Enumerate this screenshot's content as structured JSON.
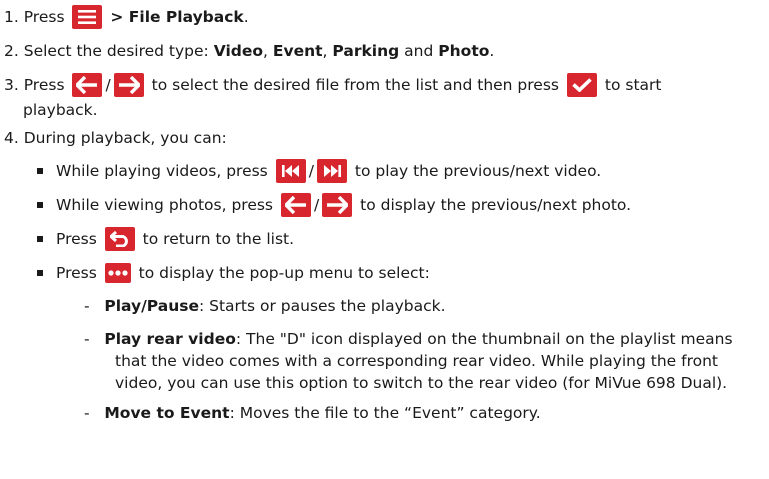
{
  "steps": {
    "s1": {
      "num": "1.",
      "pre": "Press",
      "post": "> File Playback",
      "end": "."
    },
    "s2": {
      "num": "2.",
      "pre": "Select the desired type:",
      "t1": "Video",
      "c1": ",",
      "t2": "Event",
      "c2": ",",
      "t3": "Parking",
      "and": "and",
      "t4": "Photo",
      "end": "."
    },
    "s3": {
      "num": "3.",
      "pre": "Press",
      "slash": "/",
      "mid": "to select the desired file from the list and then press",
      "post": "to start",
      "cont": "playback."
    },
    "s4": {
      "num": "4.",
      "text": "During playback, you can:"
    }
  },
  "bullets": {
    "b1": {
      "pre": "While playing videos, press",
      "slash": "/",
      "post": "to play the previous/next video."
    },
    "b2": {
      "pre": "While viewing photos, press",
      "slash": "/",
      "post": "to display the previous/next photo."
    },
    "b3": {
      "pre": "Press",
      "post": "to return to the list."
    },
    "b4": {
      "pre": "Press",
      "post": "to display the pop-up menu to select:"
    }
  },
  "menu": {
    "m1": {
      "term": "Play/Pause",
      "desc": ": Starts or pauses the playback."
    },
    "m2": {
      "term": "Play rear video",
      "desc": ": The \"D\" icon displayed on the thumbnail on the playlist means",
      "l2": "that the video comes with a corresponding rear video. While playing the front",
      "l3": "video, you can use this option to switch to the rear video (for MiVue 698 Dual)."
    },
    "m3": {
      "term": "Move to Event",
      "desc": ": Moves the file to the “Event” category."
    }
  },
  "icons": {
    "menu": "hamburger-menu-icon",
    "left": "arrow-left-icon",
    "right": "arrow-right-icon",
    "check": "checkmark-icon",
    "prev": "skip-previous-icon",
    "next": "skip-next-icon",
    "back": "return-icon",
    "more": "more-options-icon"
  },
  "colors": {
    "icon_bg": "#d8262e",
    "text": "#1a1a1a"
  }
}
